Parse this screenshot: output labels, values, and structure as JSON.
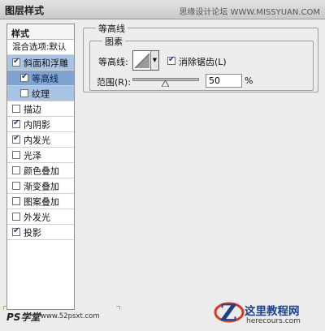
{
  "window": {
    "title": "图层样式",
    "watermark": "思缘设计论坛 WWW.MISSYUAN.COM"
  },
  "left_panel": {
    "header": "样式",
    "blending_options": "混合选项:默认",
    "items": [
      {
        "label": "斜面和浮雕",
        "checked": true
      },
      {
        "label": "等高线",
        "checked": true
      },
      {
        "label": "纹理",
        "checked": false
      },
      {
        "label": "描边",
        "checked": false
      },
      {
        "label": "内阴影",
        "checked": true
      },
      {
        "label": "内发光",
        "checked": true
      },
      {
        "label": "光泽",
        "checked": false
      },
      {
        "label": "颜色叠加",
        "checked": false
      },
      {
        "label": "渐变叠加",
        "checked": false
      },
      {
        "label": "图案叠加",
        "checked": false
      },
      {
        "label": "外发光",
        "checked": false
      },
      {
        "label": "投影",
        "checked": true
      }
    ]
  },
  "contour_panel": {
    "section_title": "等高线",
    "group_title": "图素",
    "contour_label": "等高线:",
    "antialias_label": "消除锯齿(L)",
    "antialias_checked": true,
    "range_label": "范围(R):",
    "range_value": "50",
    "range_unit": "%"
  },
  "footer": {
    "ps_logo": "PS学堂",
    "ps_site": "www.52psxt.com",
    "site_title": "这里教程网",
    "site_url": "herecours.com"
  },
  "colors": {
    "selected_row": "#7fa3d1",
    "selected_parent_row": "#a9c3e2",
    "panel_bg": "#ececec",
    "brand_blue": "#1d3f8c",
    "brand_red": "#d63a1e"
  }
}
